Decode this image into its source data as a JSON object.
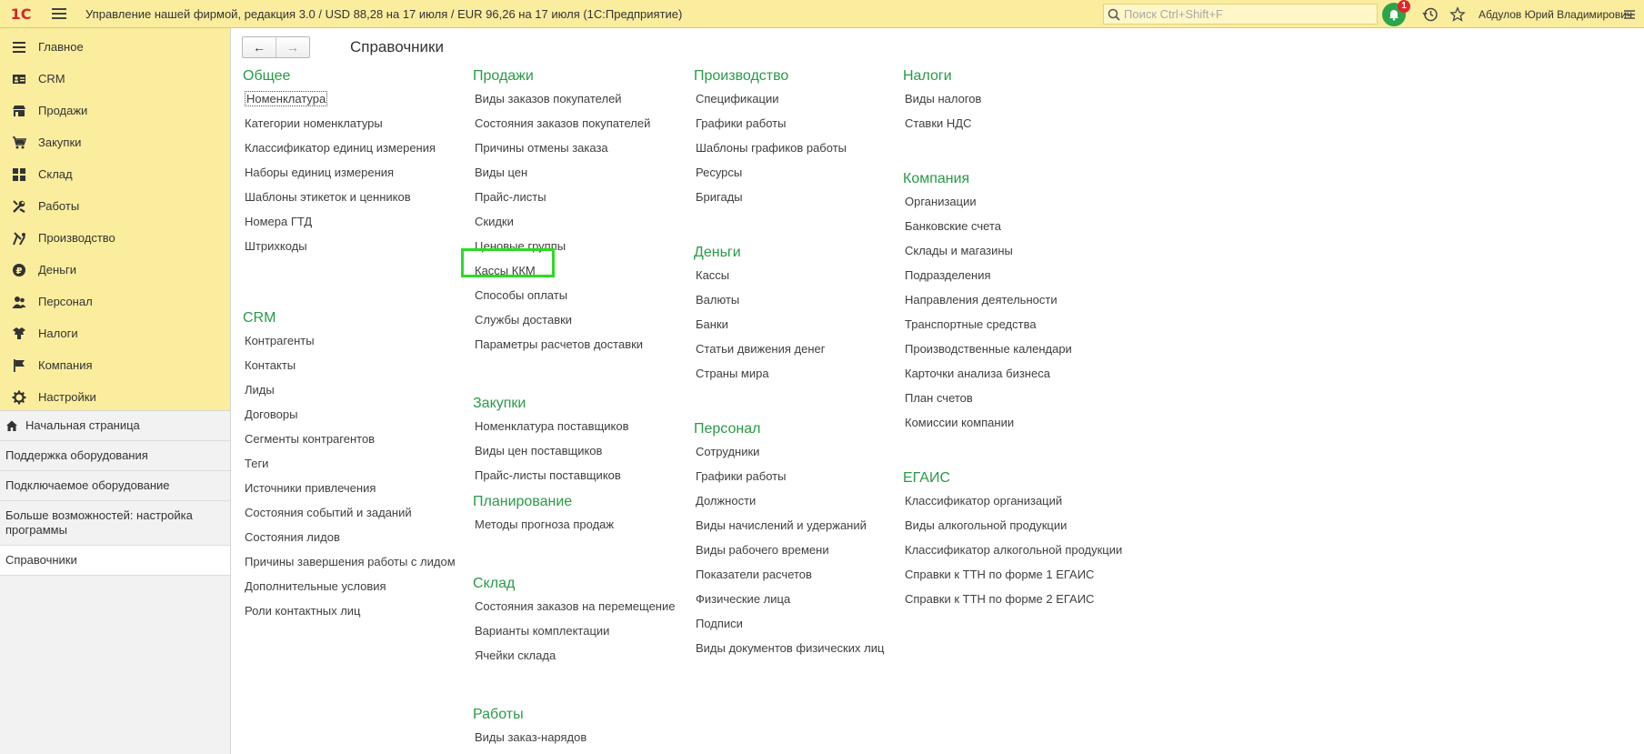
{
  "topbar": {
    "logo": "1С",
    "title": "Управление нашей фирмой, редакция 3.0 / USD 88,28 на 17 июля / EUR 96,26 на 17 июля  (1С:Предприятие)",
    "search_placeholder": "Поиск Ctrl+Shift+F",
    "notification_count": "1",
    "user": "Абдулов Юрий Владимирович"
  },
  "sidebar": {
    "sections": [
      {
        "label": "Главное",
        "icon": "list-icon"
      },
      {
        "label": "CRM",
        "icon": "crm-card-icon"
      },
      {
        "label": "Продажи",
        "icon": "shop-icon"
      },
      {
        "label": "Закупки",
        "icon": "cart-icon"
      },
      {
        "label": "Склад",
        "icon": "warehouse-grid-icon"
      },
      {
        "label": "Работы",
        "icon": "tools-icon"
      },
      {
        "label": "Производство",
        "icon": "factory-icon"
      },
      {
        "label": "Деньги",
        "icon": "ruble-coin-icon"
      },
      {
        "label": "Персонал",
        "icon": "people-icon"
      },
      {
        "label": "Налоги",
        "icon": "eagle-emblem-icon"
      },
      {
        "label": "Компания",
        "icon": "flag-icon"
      },
      {
        "label": "Настройки",
        "icon": "gear-icon"
      }
    ],
    "nav": [
      {
        "label": "Начальная страница",
        "icon": "home-icon"
      },
      {
        "label": "Поддержка оборудования"
      },
      {
        "label": "Подключаемое оборудование"
      },
      {
        "label": "Больше возможностей: настройка программы"
      },
      {
        "label": "Справочники"
      }
    ]
  },
  "main": {
    "title": "Справочники",
    "back_glyph": "←",
    "forward_glyph": "→",
    "columns": [
      {
        "groups": [
          {
            "title": "Общее",
            "items": [
              "Номенклатура",
              "Категории номенклатуры",
              "Классификатор единиц измерения",
              "Наборы единиц измерения",
              "Шаблоны этикеток и ценников",
              "Номера ГТД",
              "Штрихкоды"
            ]
          },
          {
            "title": "CRM",
            "items": [
              "Контрагенты",
              "Контакты",
              "Лиды",
              "Договоры",
              "Сегменты контрагентов",
              "Теги",
              "Источники привлечения",
              "Состояния событий и заданий",
              "Состояния лидов",
              "Причины завершения работы с лидом",
              "Дополнительные условия",
              "Роли контактных лиц"
            ]
          }
        ]
      },
      {
        "groups": [
          {
            "title": "Продажи",
            "items": [
              "Виды заказов покупателей",
              "Состояния заказов покупателей",
              "Причины отмены заказа",
              "Виды цен",
              "Прайс-листы",
              "Скидки",
              "Ценовые группы",
              "Кассы ККМ",
              "Способы оплаты",
              "Службы доставки",
              "Параметры расчетов доставки"
            ]
          },
          {
            "title": "Закупки",
            "items": [
              "Номенклатура поставщиков",
              "Виды цен поставщиков",
              "Прайс-листы поставщиков"
            ]
          },
          {
            "title": "Планирование",
            "items": [
              "Методы прогноза продаж"
            ]
          },
          {
            "title": "Склад",
            "items": [
              "Состояния заказов на перемещение",
              "Варианты комплектации",
              "Ячейки склада"
            ]
          },
          {
            "title": "Работы",
            "items": [
              "Виды заказ-нарядов"
            ]
          }
        ]
      },
      {
        "groups": [
          {
            "title": "Производство",
            "items": [
              "Спецификации",
              "Графики работы",
              "Шаблоны графиков работы",
              "Ресурсы",
              "Бригады"
            ]
          },
          {
            "title": "Деньги",
            "items": [
              "Кассы",
              "Валюты",
              "Банки",
              "Статьи движения денег",
              "Страны мира"
            ]
          },
          {
            "title": "Персонал",
            "items": [
              "Сотрудники",
              "Графики работы",
              "Должности",
              "Виды начислений и удержаний",
              "Виды рабочего времени",
              "Показатели расчетов",
              "Физические лица",
              "Подписи",
              "Виды документов физических лиц"
            ]
          }
        ]
      },
      {
        "groups": [
          {
            "title": "Налоги",
            "items": [
              "Виды налогов",
              "Ставки НДС"
            ]
          },
          {
            "title": "Компания",
            "items": [
              "Организации",
              "Банковские счета",
              "Склады и магазины",
              "Подразделения",
              "Направления деятельности",
              "Транспортные средства",
              "Производственные календари",
              "Карточки анализа бизнеса",
              "План счетов",
              "Комиссии компании"
            ]
          },
          {
            "title": "ЕГАИС",
            "items": [
              "Классификатор организаций",
              "Виды алкогольной продукции",
              "Классификатор алкогольной продукции",
              "Справки к ТТН по форме 1 ЕГАИС",
              "Справки к ТТН по форме 2 ЕГАИС"
            ]
          }
        ]
      }
    ]
  },
  "colors": {
    "panel_yellow": "#fbed9e",
    "group_green": "#2a9a47",
    "highlight_green": "#2bdc20"
  }
}
